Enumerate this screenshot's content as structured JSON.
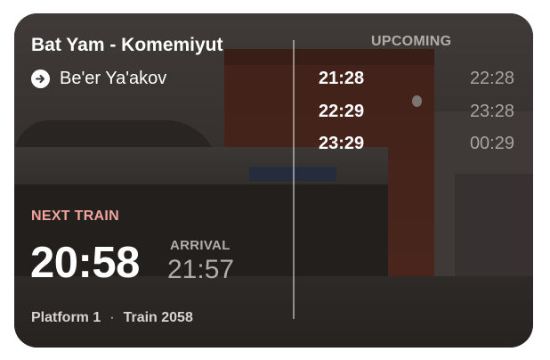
{
  "station": {
    "name": "Bat Yam - Komemiyut",
    "destination": "Be'er Ya'akov",
    "destination_icon": "arrow-circle-right-icon"
  },
  "next_train": {
    "label": "NEXT TRAIN",
    "departure": "20:58",
    "arrival_label": "ARRIVAL",
    "arrival": "21:57",
    "platform": "Platform 1",
    "separator": "·",
    "train": "Train 2058"
  },
  "upcoming": {
    "label": "UPCOMING",
    "rows": [
      {
        "departure": "21:28",
        "arrival": "22:28"
      },
      {
        "departure": "22:29",
        "arrival": "23:28"
      },
      {
        "departure": "23:29",
        "arrival": "00:29"
      }
    ]
  },
  "colors": {
    "next_label": "#f2a49d",
    "primary_text": "#ffffff",
    "muted_text": "#b2aca8"
  }
}
